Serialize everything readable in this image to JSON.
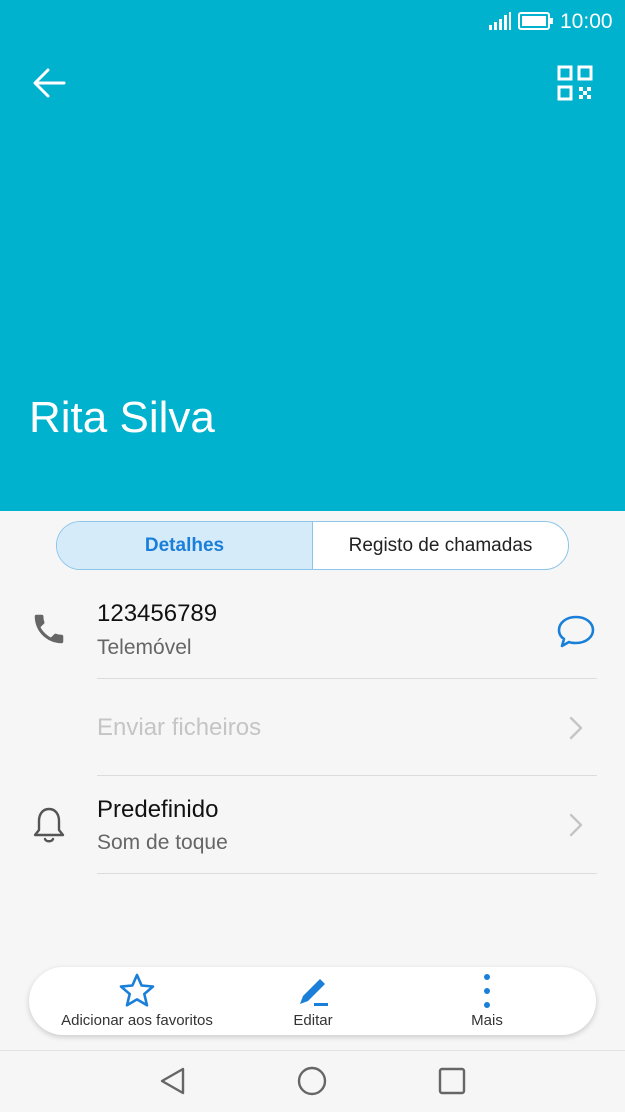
{
  "status_bar": {
    "time": "10:00",
    "signal_icon": "signal-icon",
    "battery_icon": "battery-icon"
  },
  "header": {
    "back_icon": "arrow-left-icon",
    "qr_icon": "qr-code-icon",
    "contact_name": "Rita Silva",
    "background_color": "#00b2cd"
  },
  "tabs": [
    {
      "label": "Detalhes",
      "active": true
    },
    {
      "label": "Registo de chamadas",
      "active": false
    }
  ],
  "phone": {
    "number": "123456789",
    "type": "Telemóvel",
    "icon": "phone-icon",
    "action_icon": "message-bubble-icon"
  },
  "send_files": {
    "label": "Enviar ficheiros",
    "enabled": false
  },
  "ringtone": {
    "value": "Predefinido",
    "label": "Som de toque",
    "icon": "bell-icon"
  },
  "actions": [
    {
      "label": "Adicionar aos favoritos",
      "icon": "star-icon"
    },
    {
      "label": "Editar",
      "icon": "pencil-icon"
    },
    {
      "label": "Mais",
      "icon": "more-vertical-icon"
    }
  ],
  "nav": {
    "back_icon": "nav-back-icon",
    "home_icon": "nav-home-icon",
    "recents_icon": "nav-recents-icon"
  },
  "accent_color": "#1a7fd8"
}
